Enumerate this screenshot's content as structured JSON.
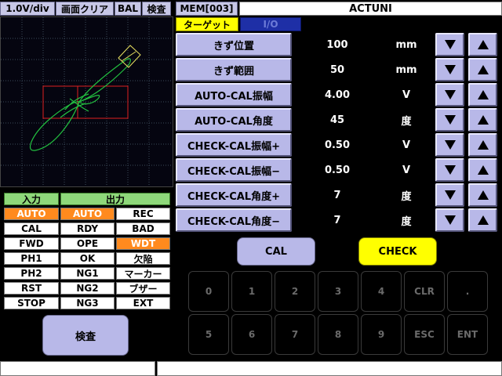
{
  "header": {
    "scale": "1.0V/div",
    "clear": "画面クリア",
    "bal": "BAL",
    "inspect": "検査",
    "mem": "MEM[003]",
    "title": "ACTUNI"
  },
  "tabs": {
    "target": "ターゲット",
    "io": "I/O"
  },
  "params": [
    {
      "label": "きず位置",
      "value": "100",
      "unit": "mm"
    },
    {
      "label": "きず範囲",
      "value": "50",
      "unit": "mm"
    },
    {
      "label": "AUTO-CAL振幅",
      "value": "4.00",
      "unit": "V"
    },
    {
      "label": "AUTO-CAL角度",
      "value": "45",
      "unit": "度"
    },
    {
      "label": "CHECK-CAL振幅+",
      "value": "0.50",
      "unit": "V"
    },
    {
      "label": "CHECK-CAL振幅−",
      "value": "0.50",
      "unit": "V"
    },
    {
      "label": "CHECK-CAL角度+",
      "value": "7",
      "unit": "度"
    },
    {
      "label": "CHECK-CAL角度−",
      "value": "7",
      "unit": "度"
    }
  ],
  "io": {
    "input_header": "入力",
    "output_header": "出力",
    "inputs": [
      "AUTO",
      "CAL",
      "FWD",
      "PH1",
      "PH2",
      "RST",
      "STOP"
    ],
    "outputs_a": [
      "AUTO",
      "RDY",
      "OPE",
      "OK",
      "NG1",
      "NG2",
      "NG3"
    ],
    "outputs_b": [
      "REC",
      "BAD",
      "WDT",
      "欠陥",
      "マーカー",
      "ブザー",
      "EXT"
    ]
  },
  "buttons": {
    "cal": "CAL",
    "check": "CHECK",
    "inspect": "検査"
  },
  "keypad": {
    "row1": [
      "0",
      "1",
      "2",
      "3",
      "4",
      "CLR",
      "."
    ],
    "row2": [
      "5",
      "6",
      "7",
      "8",
      "9",
      "ESC",
      "ENT"
    ]
  },
  "status": {
    "left": "",
    "right": ""
  },
  "colors": {
    "accent_orange": "#ff8a1e",
    "check_yellow": "#ffff00",
    "io_green": "#8ed87a"
  }
}
